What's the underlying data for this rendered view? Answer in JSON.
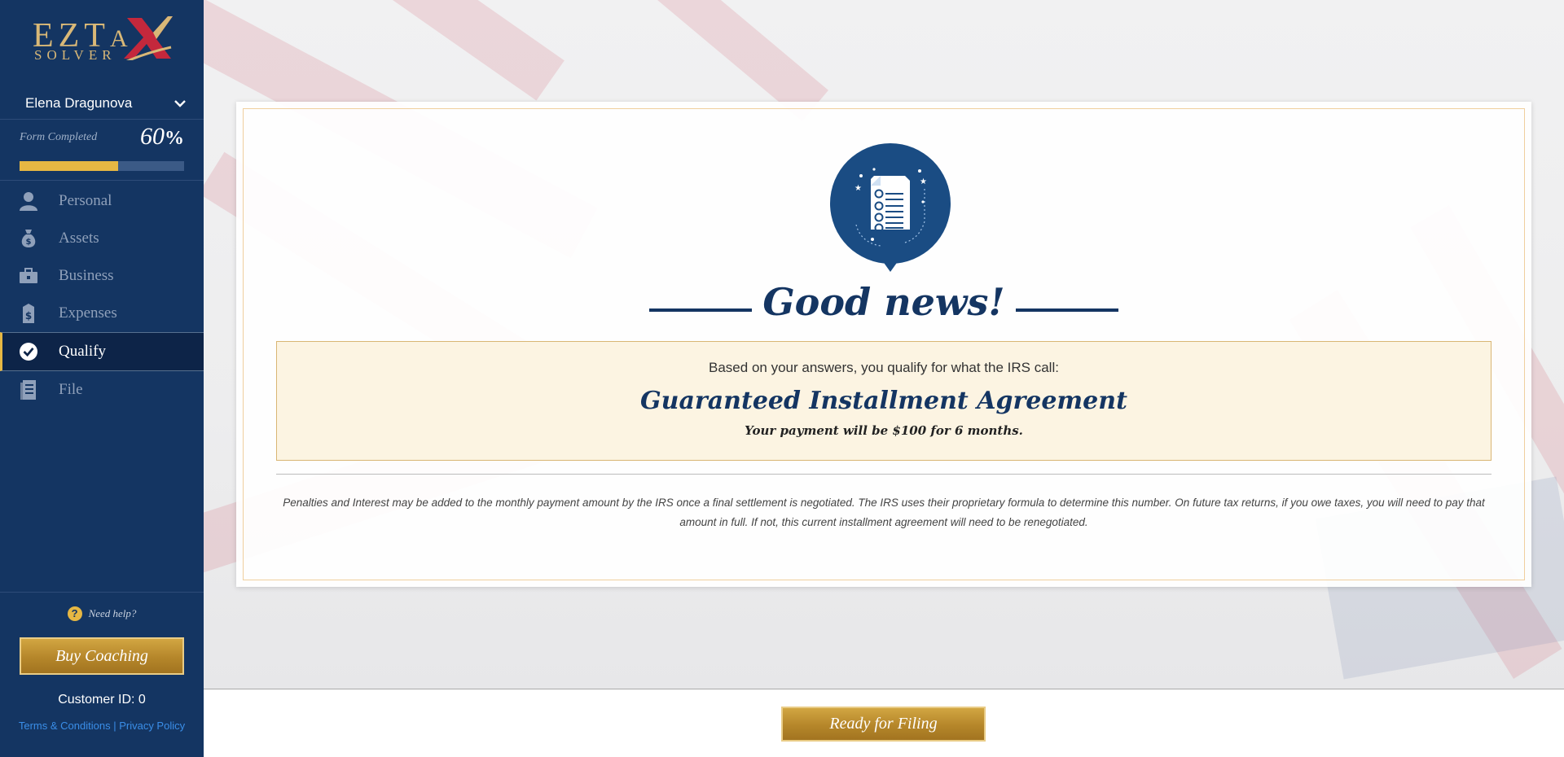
{
  "brand": {
    "logo_main_1": "EZT",
    "logo_main_a": "A",
    "logo_main_x": "X",
    "logo_sub": "SOLVER"
  },
  "user": {
    "name": "Elena Dragunova"
  },
  "progress": {
    "label": "Form Completed",
    "value": "60",
    "unit": "%",
    "fraction": 0.6
  },
  "nav": [
    {
      "label": "Personal",
      "icon": "person-icon",
      "active": false
    },
    {
      "label": "Assets",
      "icon": "money-bag-icon",
      "active": false
    },
    {
      "label": "Business",
      "icon": "briefcase-icon",
      "active": false
    },
    {
      "label": "Expenses",
      "icon": "receipt-icon",
      "active": false
    },
    {
      "label": "Qualify",
      "icon": "check-circle-icon",
      "active": true
    },
    {
      "label": "File",
      "icon": "document-icon",
      "active": false
    }
  ],
  "help": {
    "label": "Need help?"
  },
  "coaching": {
    "button_label": "Buy Coaching"
  },
  "customer": {
    "id_text": "Customer ID: 0"
  },
  "legal": {
    "terms": "Terms & Conditions",
    "separator": " | ",
    "privacy": "Privacy Policy"
  },
  "result": {
    "heading": "Good news!",
    "intro": "Based on your answers, you qualify for what the IRS call:",
    "plan": "Guaranteed Installment Agreement",
    "payment": "Your payment will be $100 for 6 months.",
    "disclaimer": "Penalties and Interest may be added to the monthly payment amount by the IRS once a final settlement is negotiated. The IRS uses their proprietary formula to determine this number. On future tax returns, if you owe taxes, you will need to pay that amount in full. If not, this current installment agreement will need to be renegotiated."
  },
  "footer": {
    "file_button_label": "Ready for Filing"
  },
  "colors": {
    "navy": "#143562",
    "gold": "#e6b743",
    "sidebar_active": "#0d2448",
    "link_blue": "#3a8ee8"
  }
}
